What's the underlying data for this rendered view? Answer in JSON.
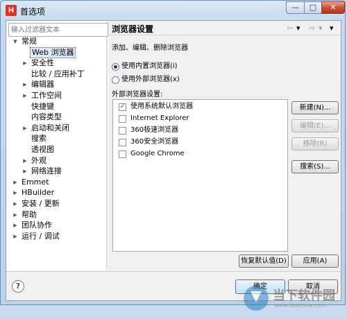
{
  "window": {
    "title": "首选项",
    "app_icon_letter": "H",
    "controls": {
      "minimize": "—",
      "maximize": "□",
      "close": "✕"
    }
  },
  "filter": {
    "placeholder": "输入过滤器文本"
  },
  "tree": [
    {
      "label": "常规",
      "level": 0,
      "arrow": "▼"
    },
    {
      "label": "Web 浏览器",
      "level": 1,
      "arrow": "",
      "selected": true
    },
    {
      "label": "安全性",
      "level": 1,
      "arrow": "▶"
    },
    {
      "label": "比较 / 应用补丁",
      "level": 1,
      "arrow": ""
    },
    {
      "label": "编辑器",
      "level": 1,
      "arrow": "▶"
    },
    {
      "label": "工作空间",
      "level": 1,
      "arrow": "▶"
    },
    {
      "label": "快捷键",
      "level": 1,
      "arrow": ""
    },
    {
      "label": "内容类型",
      "level": 1,
      "arrow": ""
    },
    {
      "label": "启动和关闭",
      "level": 1,
      "arrow": "▶"
    },
    {
      "label": "搜索",
      "level": 1,
      "arrow": ""
    },
    {
      "label": "透视图",
      "level": 1,
      "arrow": ""
    },
    {
      "label": "外观",
      "level": 1,
      "arrow": "▶"
    },
    {
      "label": "网络连接",
      "level": 1,
      "arrow": "▶"
    },
    {
      "label": "Emmet",
      "level": 0,
      "arrow": "▶"
    },
    {
      "label": "HBuilder",
      "level": 0,
      "arrow": "▶"
    },
    {
      "label": "安装 / 更新",
      "level": 0,
      "arrow": "▶"
    },
    {
      "label": "帮助",
      "level": 0,
      "arrow": "▶"
    },
    {
      "label": "团队协作",
      "level": 0,
      "arrow": "▶"
    },
    {
      "label": "运行 / 调试",
      "level": 0,
      "arrow": "▶"
    }
  ],
  "page": {
    "title": "浏览器设置",
    "description": "添加、编辑、删除浏览器",
    "nav": {
      "back": "⇦",
      "back_menu": "▾",
      "forward": "⇨",
      "forward_menu": "▾",
      "view_menu": "▾"
    },
    "radio_internal": "使用内置浏览器(i)",
    "radio_external": "使用外部浏览器(x)",
    "group_label": "外部浏览器设置:",
    "browsers": [
      {
        "label": "使用系统默认浏览器",
        "checked": true
      },
      {
        "label": "Internet Explorer",
        "checked": false
      },
      {
        "label": "360极速浏览器",
        "checked": false
      },
      {
        "label": "360安全浏览器",
        "checked": false
      },
      {
        "label": "Google Chrome",
        "checked": false
      }
    ],
    "buttons": {
      "new": "新建(N)...",
      "edit": "编辑(E)...",
      "remove": "移除(R)",
      "search": "搜索(S)...",
      "restore_defaults": "恢复默认值(D)",
      "apply": "应用(A)"
    }
  },
  "footer": {
    "help": "?",
    "ok": "确定",
    "cancel": "取消"
  },
  "watermark": {
    "name": "当下软件园",
    "url": "www.downxia.com"
  },
  "colors": {
    "close_button": "#c7503a",
    "selection": "#dde9f8",
    "titlebar": "#c6d9ee"
  }
}
